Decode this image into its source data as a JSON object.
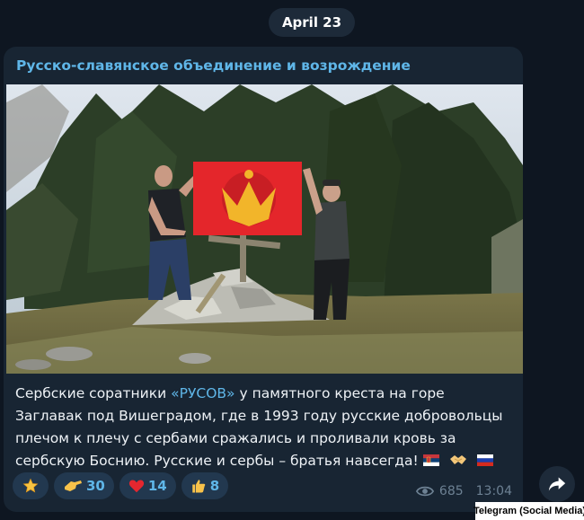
{
  "date_label": "April 23",
  "channel_name": "Русско-славянское объединение и возрождение",
  "post": {
    "text_before": "Сербские соратники ",
    "mention": "«РУСОВ»",
    "text_after": " у памятного креста на горе Заглавак под Вишеградом, где в 1993 году русские добровольцы плечом к плечу с сербами сражались и проливали кровь за сербскую Боснию. Русские и сербы – братья навсегда! ",
    "emojis": [
      "flag-serbia",
      "handshake",
      "flag-russia"
    ]
  },
  "reactions": [
    {
      "icon": "star-icon",
      "count": ""
    },
    {
      "icon": "saluting-hand-icon",
      "count": "30"
    },
    {
      "icon": "heart-icon",
      "count": "14"
    },
    {
      "icon": "thumbs-up-icon",
      "count": "8"
    }
  ],
  "views": "685",
  "time": "13:04",
  "source_credit": "Telegram (Social Media)",
  "colors": {
    "background": "#0e1621",
    "bubble": "#182533",
    "accent": "#5fb6e8",
    "flag_red": "#e4262b",
    "flag_gold": "#f2b52a"
  }
}
